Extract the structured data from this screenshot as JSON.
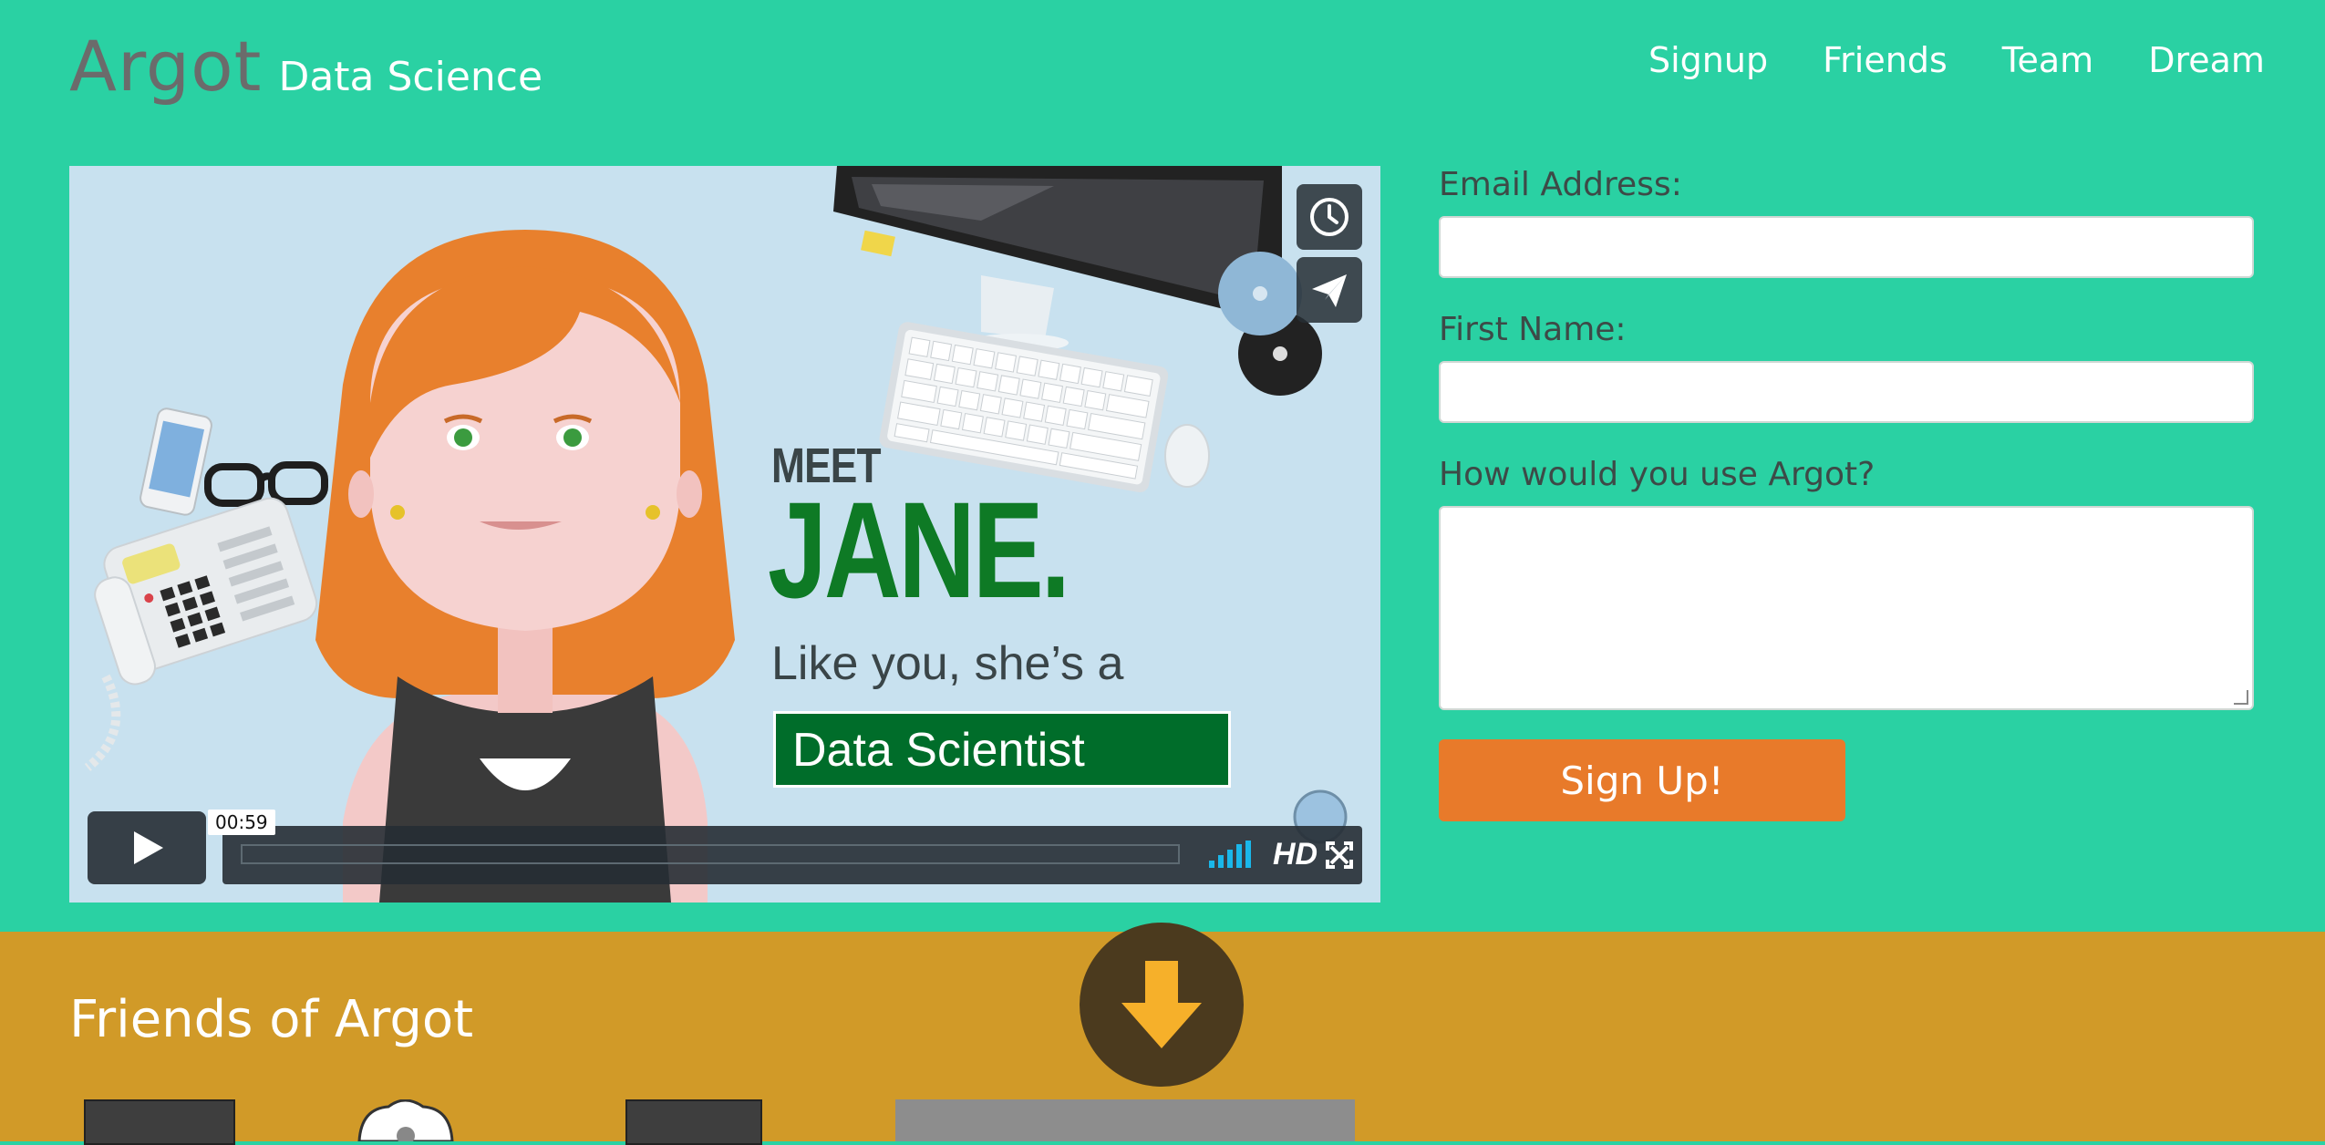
{
  "header": {
    "logo": "Argot",
    "subtitle": "Data Science",
    "nav": [
      "Signup",
      "Friends",
      "Team",
      "Dream"
    ]
  },
  "video": {
    "headline_meet": "MEET",
    "headline_name": "JANE.",
    "tagline": "Like you, she’s a",
    "role": "Data Scientist",
    "timestamp": "00:59",
    "hd_label": "HD",
    "play_progress": 0
  },
  "form": {
    "email_label": "Email Address:",
    "email_value": "",
    "firstname_label": "First Name:",
    "firstname_value": "",
    "usage_label": "How would you use Argot?",
    "usage_value": "",
    "submit_label": "Sign Up!"
  },
  "friends": {
    "title": "Friends of Argot"
  },
  "colors": {
    "hero_bg": "#2ad1a3",
    "friends_bg": "#d19a28",
    "button": "#e87a2a",
    "role_box": "#006d2a",
    "name_green": "#0e7a25"
  }
}
